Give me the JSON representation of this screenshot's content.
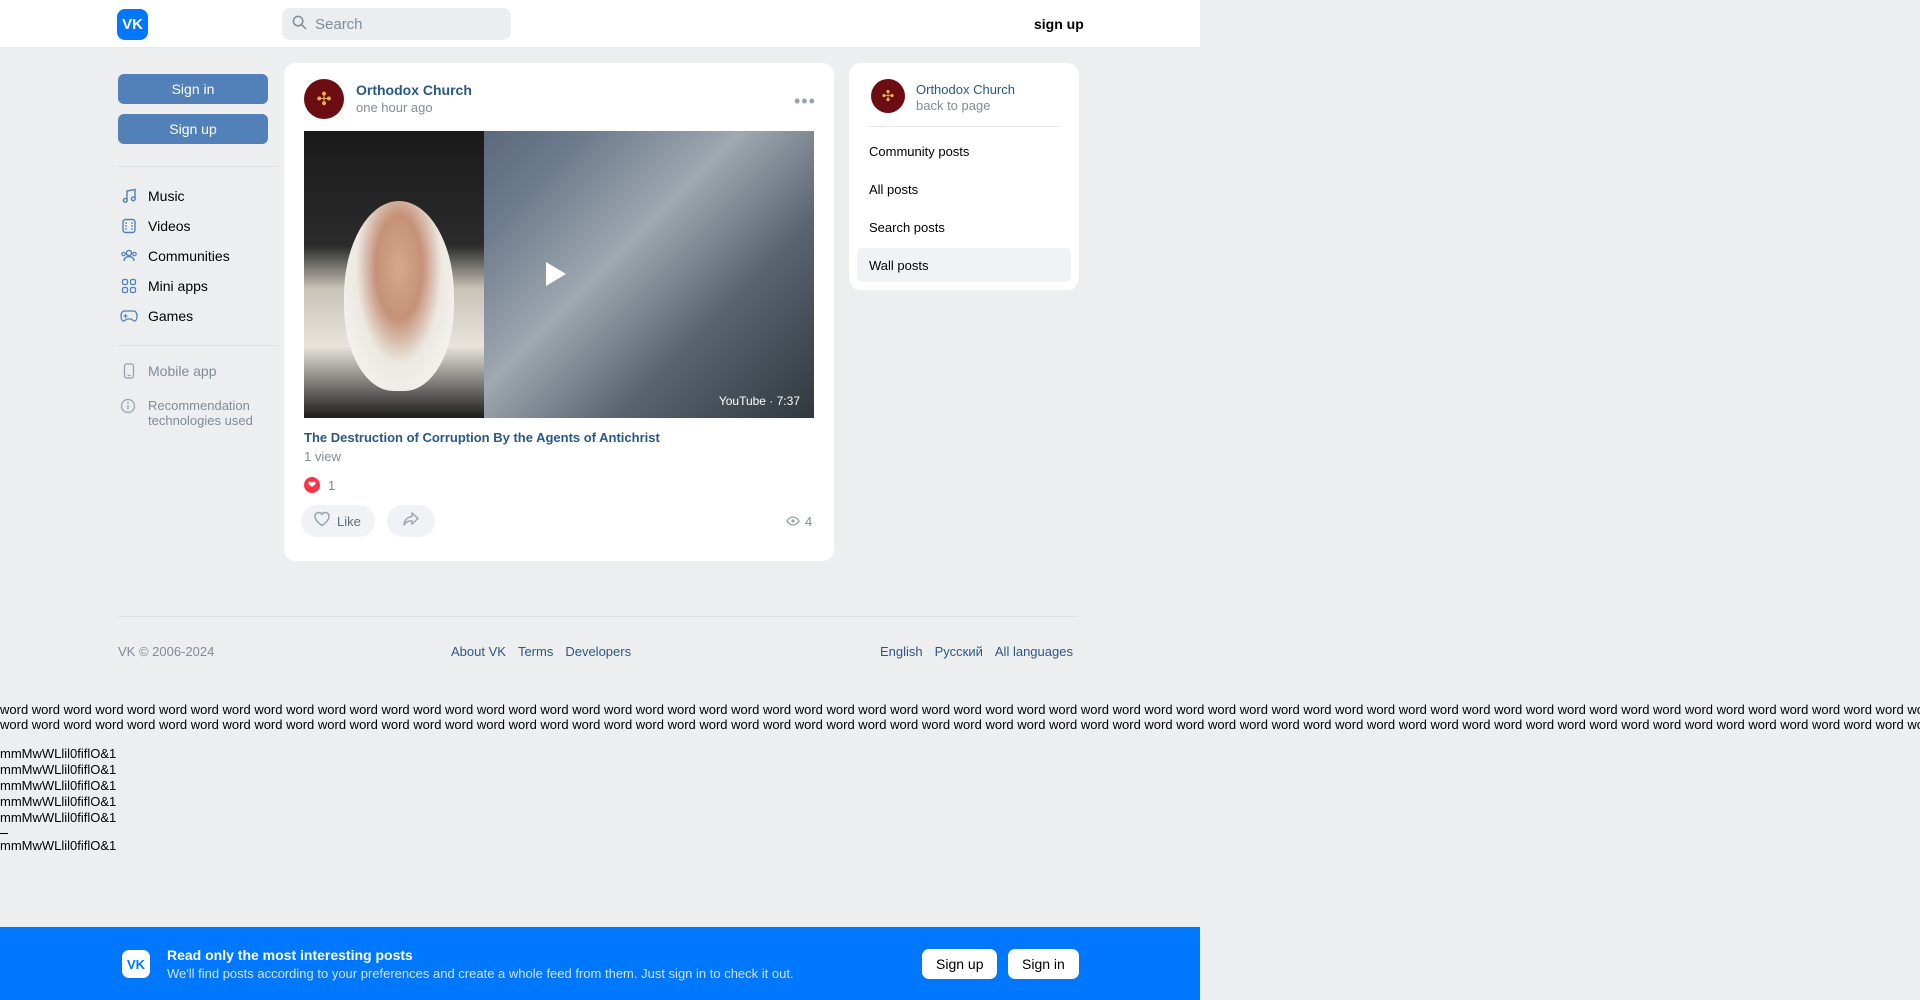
{
  "header": {
    "logo_text": "VK",
    "search_placeholder": "Search",
    "signup_label": "sign up"
  },
  "sidebar": {
    "signin_label": "Sign in",
    "signup_label": "Sign up",
    "items": [
      {
        "label": "Music",
        "icon": "music-note-icon"
      },
      {
        "label": "Videos",
        "icon": "film-icon"
      },
      {
        "label": "Communities",
        "icon": "users-icon"
      },
      {
        "label": "Mini apps",
        "icon": "grid-icon"
      },
      {
        "label": "Games",
        "icon": "gamepad-icon"
      }
    ],
    "mobile_app": "Mobile app",
    "recommendation_line1": "Recommendation",
    "recommendation_line2": "technologies used"
  },
  "post": {
    "author": "Orthodox Church",
    "time": "one hour ago",
    "video_source": "YouTube · 7:37",
    "video_title": "The Destruction of Corruption By the Agents of Antichrist",
    "video_views": "1 view",
    "reactions_count": "1",
    "like_label": "Like",
    "views_count": "4"
  },
  "right_panel": {
    "name": "Orthodox Church",
    "back": "back to page",
    "items": [
      "Community posts",
      "All posts",
      "Search posts",
      "Wall posts"
    ],
    "active_item": "Wall posts"
  },
  "footer": {
    "copyright": "VK © 2006-2024",
    "links": [
      "About VK",
      "Terms",
      "Developers"
    ],
    "languages": [
      "English",
      "Русский",
      "All languages"
    ]
  },
  "debug": {
    "word_line_1": "word word word word word word word word word word word word word word word word word word word word word word word word word word word word word word word word word word word word word word word word word word word word word word word word word word word word word word word word word word word word word word word word word word",
    "word_line_2": "word word word word word word word word word word word word word word word word word word word word word word word word word word word word word word word word word word word word word word word word word word word word word word word word word word word word word word word word word word word word word word word word word word",
    "glyphs": [
      "mmMwWLlil0fiflO&1",
      "mmMwWLlil0fiflO&1",
      "mmMwWLlil0fiflO&1",
      "mmMwWLlil0fiflO&1",
      "mmMwWLlil0fiflO&1",
      "mmMwWLlil0fiflO&1"
    ]
  },
  "banner": {
    "logo_text": "VK",
    "title": "Read only the most interesting posts",
    "subtitle": "We'll find posts according to your preferences and create a whole feed from them. Just sign in to check it out.",
    "signup_label": "Sign up",
    "signin_label": "Sign in"
  },
  "colors": {
    "accent": "#0077ff",
    "link": "#2a5885",
    "button": "#5181b8",
    "muted": "#818c99",
    "background": "#edeef0"
  }
}
